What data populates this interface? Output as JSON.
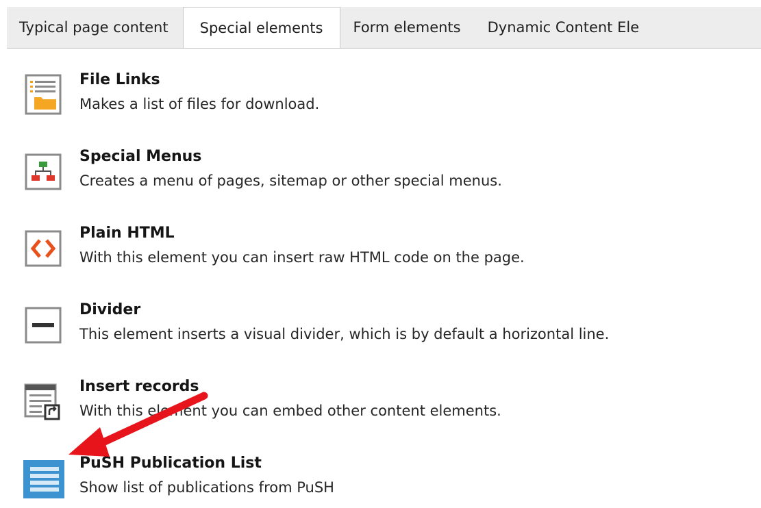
{
  "tabs": [
    {
      "label": "Typical page content",
      "active": false
    },
    {
      "label": "Special elements",
      "active": true
    },
    {
      "label": "Form elements",
      "active": false
    },
    {
      "label": "Dynamic Content Ele",
      "active": false
    }
  ],
  "items": [
    {
      "title": "File Links",
      "description": "Makes a list of files for download.",
      "icon": "file-links-icon"
    },
    {
      "title": "Special Menus",
      "description": "Creates a menu of pages, sitemap or other special menus.",
      "icon": "sitemap-icon"
    },
    {
      "title": "Plain HTML",
      "description": "With this element you can insert raw HTML code on the page.",
      "icon": "code-brackets-icon"
    },
    {
      "title": "Divider",
      "description": "This element inserts a visual divider, which is by default a horizontal line.",
      "icon": "divider-icon"
    },
    {
      "title": "Insert records",
      "description": "With this element you can embed other content elements.",
      "icon": "insert-records-icon"
    },
    {
      "title": "PuSH Publication List",
      "description": "Show list of publications from PuSH",
      "icon": "publication-list-icon"
    }
  ],
  "annotation": {
    "arrow_color": "#e8141b"
  },
  "colors": {
    "tab_bar": "#ededed",
    "border": "#c8c8c8",
    "code_orange": "#e8511c",
    "push_blue": "#3d93cf"
  }
}
